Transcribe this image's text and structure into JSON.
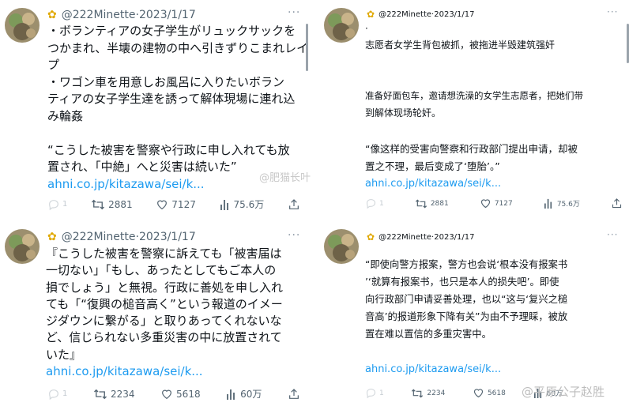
{
  "watermark": {
    "center": "@肥猫长叶",
    "bottom": "@平原公子赵胜"
  },
  "tweets": {
    "t1": {
      "handle": "@222Minette",
      "date": "·2023/1/17",
      "lines": [
        "・ボランティアの女子学生がリュックサックを",
        "つかまれ、半壊の建物の中へ引きずりこまれレイ",
        "プ",
        "・ワゴン車を用意しお風呂に入りたいボラン",
        "ティアの女子学生達を誘って解体現場に連れ込",
        "み輪姦",
        "",
        "“こうした被害を警察や行政に申し入れても放",
        "置され、「中絶」へと災害は続いた”"
      ],
      "link": "ahni.co.jp/kitazawa/sei/k...",
      "replies": "1",
      "retweets": "2881",
      "likes": "7127",
      "views": "75.6万"
    },
    "t2": {
      "handle": "@222Minette",
      "date": "·2023/1/17",
      "lines": [
        "·",
        "志愿者女学生背包被抓，被拖进半毁建筑强奸",
        "",
        "",
        "准备好面包车，邀请想洗澡的女学生志愿者，把她们带",
        "到解体现场轮奸。",
        "",
        "",
        "“像这样的受害向警察和行政部门提出申请，却被",
        "置之不理，最后变成了‘堕胎’。”"
      ],
      "link": "ahni.co.jp/kitazawa/sei/k...",
      "replies": "1",
      "retweets": "2881",
      "likes": "7127",
      "views": "75.6万"
    },
    "t3": {
      "handle": "@222Minette",
      "date": "·2023/1/17",
      "lines": [
        "『こうした被害を警察に訴えても「被害届は",
        "一切ない」「もし、あったとしてもご本人の",
        "損でしょう」と無視。行政に善処を申し入れ",
        "ても「“復興の槌音高く”という報道のイメー",
        "ジダウンに繋がる」と取りあってくれないな",
        "ど、信じられない多重災害の中に放置されて",
        "いた』"
      ],
      "link": "ahni.co.jp/kitazawa/sei/k...",
      "replies": "1",
      "retweets": "2234",
      "likes": "5618",
      "views": "60万"
    },
    "t4": {
      "handle": "@222Minette",
      "date": "·2023/1/17",
      "lines": [
        "“即使向警方报案，警方也会说‘根本没有报案书",
        "’‘就算有报案书，也只是本人的损失吧’。即使",
        "向行政部门申请妥善处理，也以“这与‘复兴之槌",
        "音高’的报道形象下降有关”为由不予理睬，被放",
        "置在难以置信的多重灾害中。"
      ],
      "link": "ahni.co.jp/kitazawa/sei/k...",
      "replies": "1",
      "retweets": "2234",
      "likes": "5618",
      "views": "60万"
    }
  }
}
